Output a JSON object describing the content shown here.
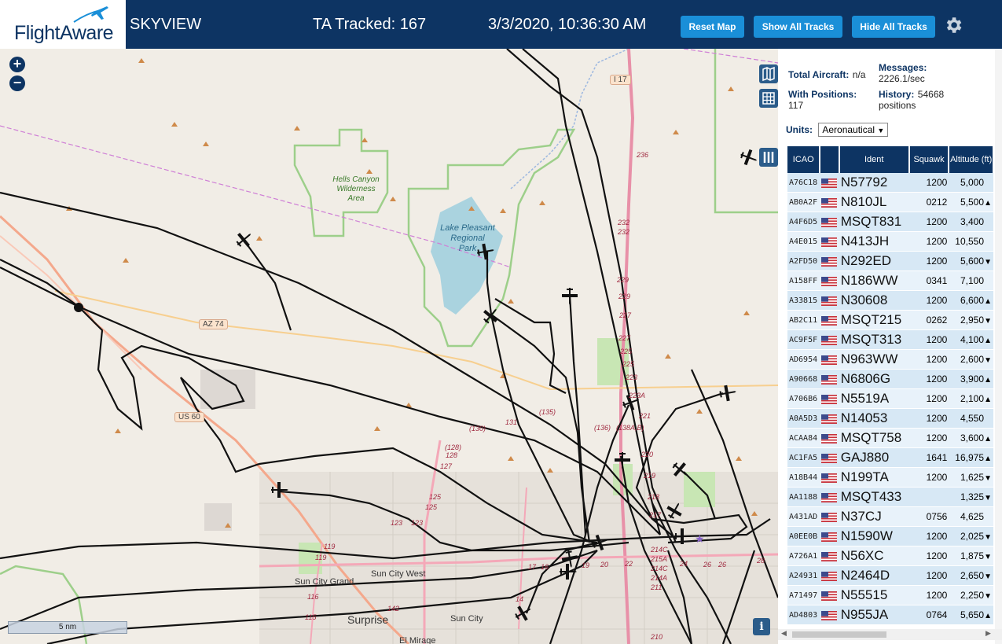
{
  "header": {
    "logo_text": "FlightAware",
    "app_name": "SKYVIEW",
    "tracked": "TA Tracked: 167",
    "datetime": "3/3/2020, 10:36:30 AM",
    "reset_map_label": "Reset Map",
    "show_all_label": "Show All Tracks",
    "hide_all_label": "Hide All Tracks"
  },
  "map": {
    "labels": {
      "hells_canyon": [
        "Hells Canyon",
        "Wilderness",
        "Area"
      ],
      "lake_pleasant": [
        "Lake Pleasant",
        "Regional",
        "Park"
      ],
      "az74": "AZ 74",
      "us60": "US 60",
      "i17": "I 17",
      "sun_city_grand": "Sun City Grand",
      "sun_city_west": "Sun City West",
      "sun_city": "Sun City",
      "surprise": "Surprise",
      "el_mirage": "El Mirage",
      "route_labels": [
        "236",
        "232",
        "232",
        "229",
        "229",
        "227",
        "227",
        "225",
        "225",
        "223",
        "223A",
        "221",
        "220",
        "219",
        "218",
        "217",
        "214C",
        "215A",
        "214C",
        "214A",
        "211",
        "210",
        "(135)",
        "(130)",
        "131",
        "(136)",
        "(138A,B)",
        "(128)",
        "128",
        "127",
        "125",
        "125",
        "123",
        "123",
        "119",
        "119",
        "116",
        "115",
        "142",
        "17",
        "16",
        "19",
        "20",
        "22",
        "24",
        "26",
        "26",
        "28",
        "14"
      ]
    },
    "scale_label": "5 nm",
    "info_label": "i"
  },
  "panel": {
    "total_aircraft_label": "Total Aircraft:",
    "total_aircraft_value": "n/a",
    "with_positions_label": "With Positions:",
    "with_positions_value": "117",
    "messages_label": "Messages:",
    "messages_value": "2226.1/sec",
    "history_label": "History:",
    "history_value": "54668",
    "history_unit": "positions",
    "units_label": "Units:",
    "units_value": "Aeronautical",
    "columns": [
      "ICAO",
      "",
      "Ident",
      "Squawk",
      "Altitude (ft)"
    ],
    "rows": [
      {
        "icao": "A76C18",
        "ident": "N57792",
        "squawk": "1200",
        "alt": "5,000",
        "trend": ""
      },
      {
        "icao": "AB0A2F",
        "ident": "N810JL",
        "squawk": "0212",
        "alt": "5,500",
        "trend": "▲"
      },
      {
        "icao": "A4F6D5",
        "ident": "MSQT831",
        "squawk": "1200",
        "alt": "3,400",
        "trend": ""
      },
      {
        "icao": "A4E015",
        "ident": "N413JH",
        "squawk": "1200",
        "alt": "10,550",
        "trend": ""
      },
      {
        "icao": "A2FD50",
        "ident": "N292ED",
        "squawk": "1200",
        "alt": "5,600",
        "trend": "▼"
      },
      {
        "icao": "A158FF",
        "ident": "N186WW",
        "squawk": "0341",
        "alt": "7,100",
        "trend": ""
      },
      {
        "icao": "A33815",
        "ident": "N30608",
        "squawk": "1200",
        "alt": "6,600",
        "trend": "▲"
      },
      {
        "icao": "AB2C11",
        "ident": "MSQT215",
        "squawk": "0262",
        "alt": "2,950",
        "trend": "▼"
      },
      {
        "icao": "AC9F5F",
        "ident": "MSQT313",
        "squawk": "1200",
        "alt": "4,100",
        "trend": "▲"
      },
      {
        "icao": "AD6954",
        "ident": "N963WW",
        "squawk": "1200",
        "alt": "2,600",
        "trend": "▼"
      },
      {
        "icao": "A90668",
        "ident": "N6806G",
        "squawk": "1200",
        "alt": "3,900",
        "trend": "▲"
      },
      {
        "icao": "A706B6",
        "ident": "N5519A",
        "squawk": "1200",
        "alt": "2,100",
        "trend": "▲"
      },
      {
        "icao": "A0A5D3",
        "ident": "N14053",
        "squawk": "1200",
        "alt": "4,550",
        "trend": ""
      },
      {
        "icao": "ACAA84",
        "ident": "MSQT758",
        "squawk": "1200",
        "alt": "3,600",
        "trend": "▲"
      },
      {
        "icao": "AC1FA5",
        "ident": "GAJ880",
        "squawk": "1641",
        "alt": "16,975",
        "trend": "▲"
      },
      {
        "icao": "A18B44",
        "ident": "N199TA",
        "squawk": "1200",
        "alt": "1,625",
        "trend": "▼"
      },
      {
        "icao": "AA1188",
        "ident": "MSQT433",
        "squawk": "",
        "alt": "1,325",
        "trend": "▼"
      },
      {
        "icao": "A431AD",
        "ident": "N37CJ",
        "squawk": "0756",
        "alt": "4,625",
        "trend": ""
      },
      {
        "icao": "A0EE0B",
        "ident": "N1590W",
        "squawk": "1200",
        "alt": "2,025",
        "trend": "▼"
      },
      {
        "icao": "A726A1",
        "ident": "N56XC",
        "squawk": "1200",
        "alt": "1,875",
        "trend": "▼"
      },
      {
        "icao": "A24931",
        "ident": "N2464D",
        "squawk": "1200",
        "alt": "2,650",
        "trend": "▼"
      },
      {
        "icao": "A71497",
        "ident": "N55515",
        "squawk": "1200",
        "alt": "2,250",
        "trend": "▼"
      },
      {
        "icao": "AD4803",
        "ident": "N955JA",
        "squawk": "0764",
        "alt": "5,650",
        "trend": "▲"
      }
    ]
  }
}
